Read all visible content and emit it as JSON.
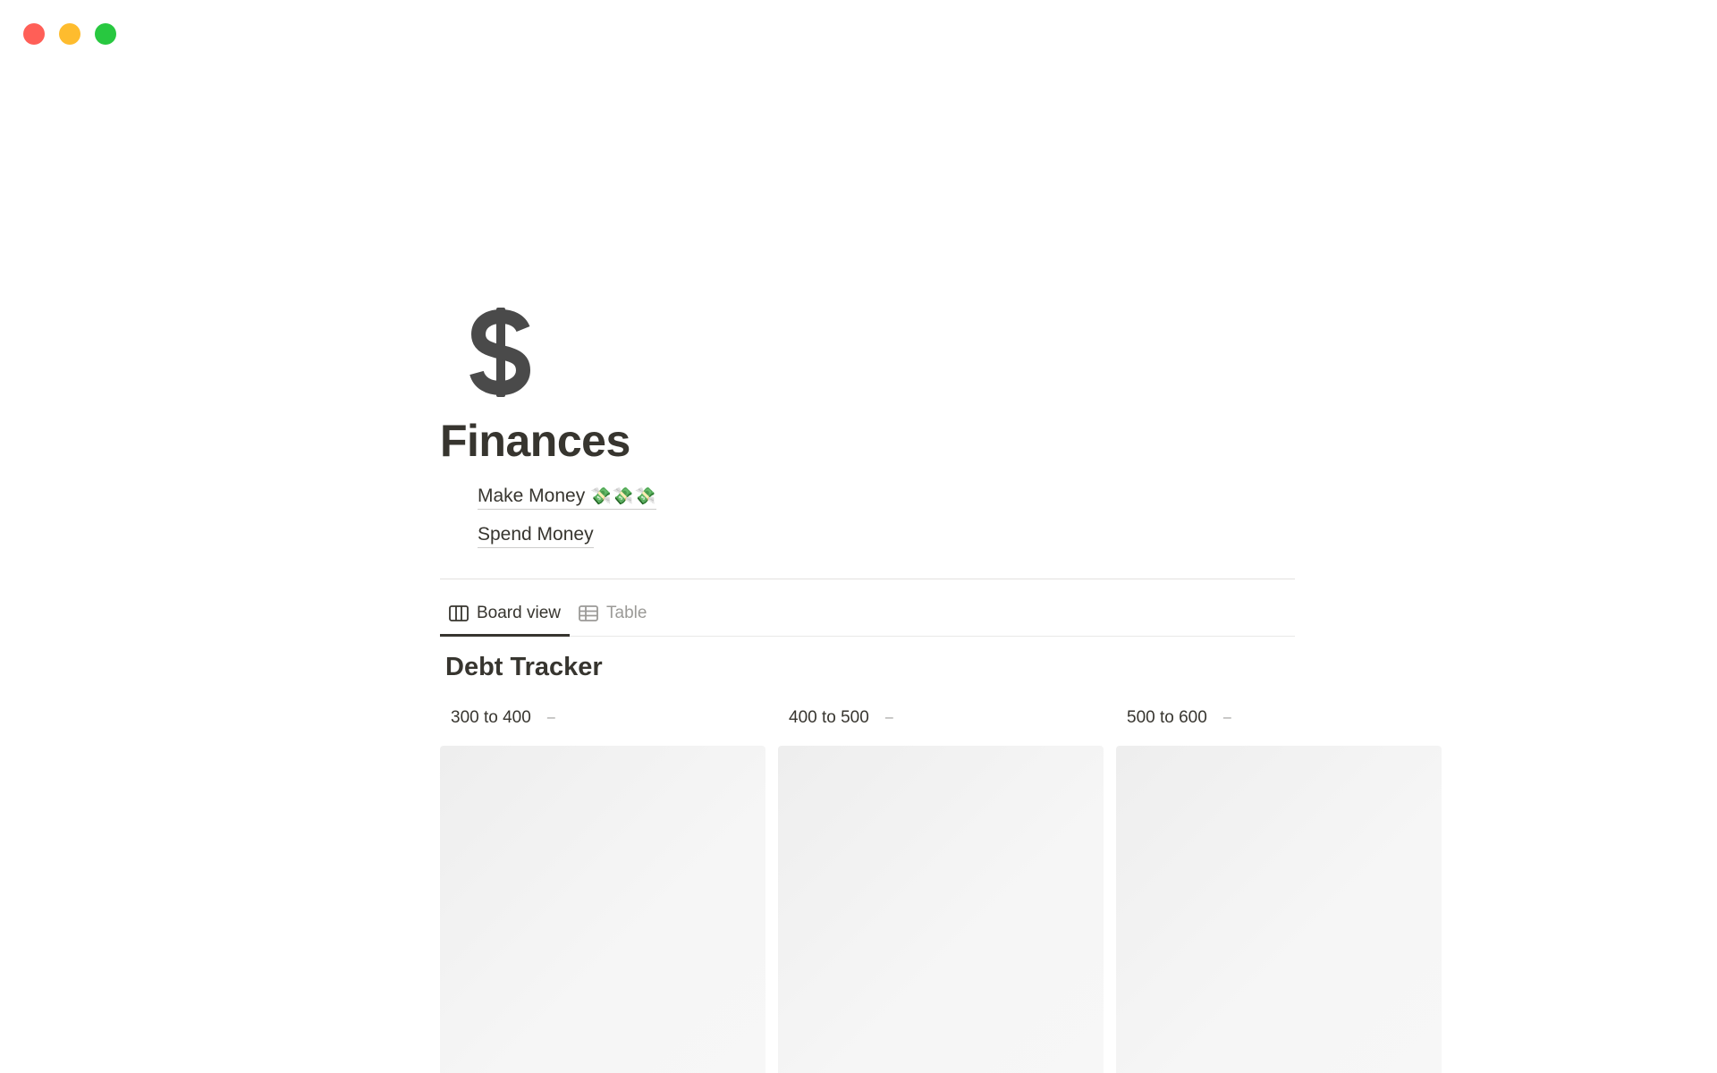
{
  "window": {
    "controls": [
      "close",
      "minimize",
      "zoom"
    ],
    "colors": {
      "close": "#ff5f57",
      "minimize": "#febc2e",
      "zoom": "#28c840"
    }
  },
  "page": {
    "icon": "dollar-sign-icon",
    "title": "Finances",
    "links": [
      {
        "label": "Make Money",
        "emoji": "💸💸💸"
      },
      {
        "label": "Spend Money",
        "emoji": ""
      }
    ]
  },
  "views": {
    "tabs": [
      {
        "label": "Board view",
        "icon": "board-icon",
        "active": true
      },
      {
        "label": "Table",
        "icon": "table-icon",
        "active": false
      }
    ]
  },
  "database": {
    "title": "Debt Tracker",
    "columns": [
      {
        "label": "300 to 400",
        "count": "–"
      },
      {
        "label": "400 to 500",
        "count": "–"
      },
      {
        "label": "500 to 600",
        "count": "–"
      }
    ]
  }
}
